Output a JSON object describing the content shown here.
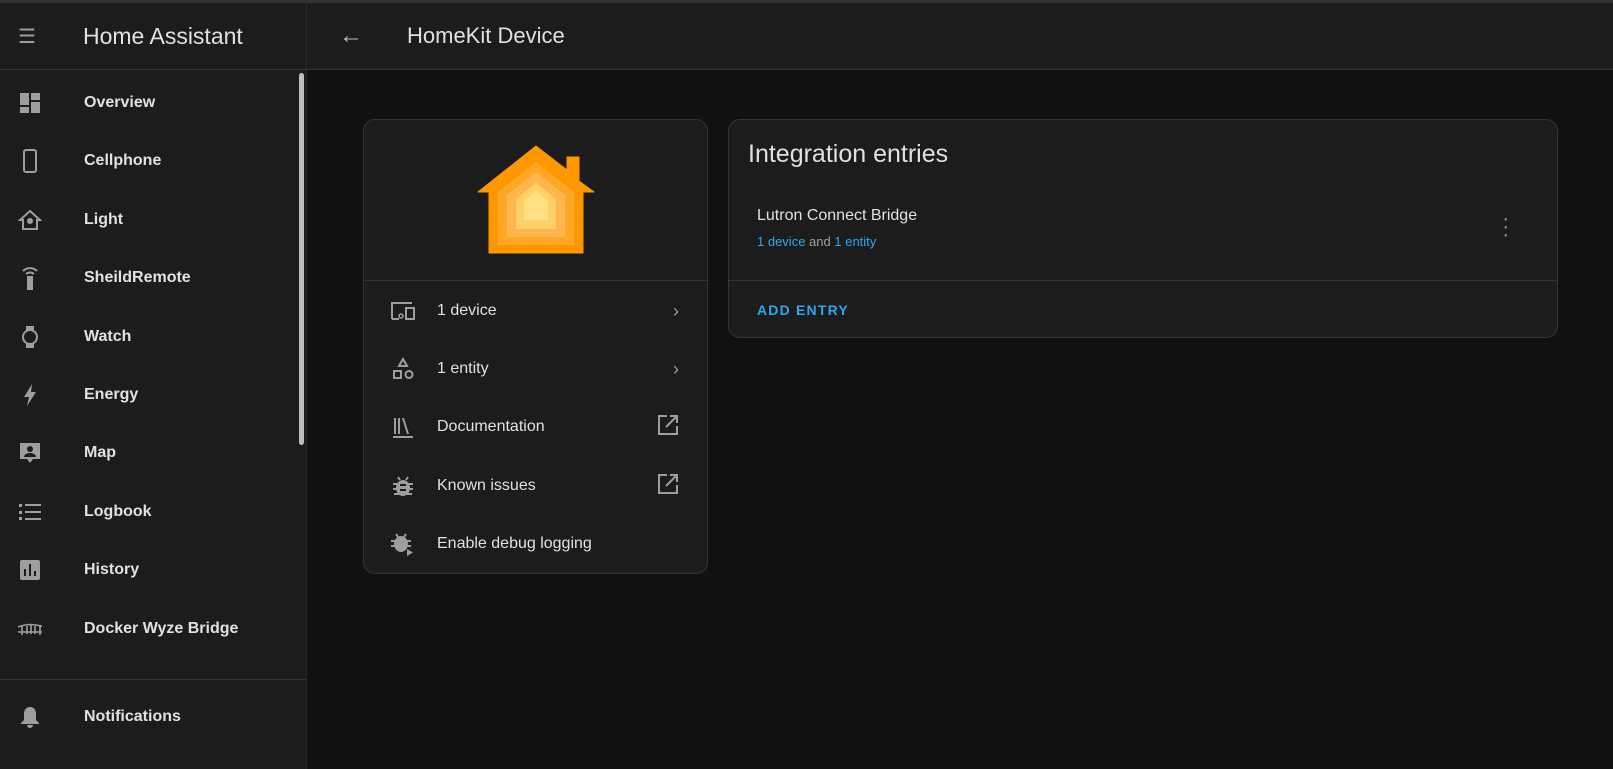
{
  "sidebar": {
    "title": "Home Assistant",
    "items": [
      {
        "label": "Overview",
        "icon": "dashboard-icon"
      },
      {
        "label": "Cellphone",
        "icon": "cellphone-icon"
      },
      {
        "label": "Light",
        "icon": "home-lightbulb-icon"
      },
      {
        "label": "SheildRemote",
        "icon": "remote-icon"
      },
      {
        "label": "Watch",
        "icon": "watch-icon"
      },
      {
        "label": "Energy",
        "icon": "lightning-bolt-icon"
      },
      {
        "label": "Map",
        "icon": "map-account-icon"
      },
      {
        "label": "Logbook",
        "icon": "format-list-icon"
      },
      {
        "label": "History",
        "icon": "chart-box-icon"
      },
      {
        "label": "Docker Wyze Bridge",
        "icon": "bridge-icon"
      }
    ],
    "notifications": "Notifications"
  },
  "header": {
    "title": "HomeKit Device"
  },
  "info_card": {
    "rows": [
      {
        "label": "1 device",
        "icon": "devices-icon",
        "end": "chevron-right-icon"
      },
      {
        "label": "1 entity",
        "icon": "shape-icon",
        "end": "chevron-right-icon"
      },
      {
        "label": "Documentation",
        "icon": "bookshelf-icon",
        "end": "open-in-new-icon"
      },
      {
        "label": "Known issues",
        "icon": "bug-icon",
        "end": "open-in-new-icon"
      },
      {
        "label": "Enable debug logging",
        "icon": "bug-play-icon",
        "end": ""
      }
    ]
  },
  "entries_card": {
    "title": "Integration entries",
    "entry": {
      "name": "Lutron Connect Bridge",
      "devices_link": "1 device",
      "and": "and",
      "entities_link": "1 entity"
    },
    "add_label": "ADD ENTRY"
  },
  "colors": {
    "accent": "#2ba7f2",
    "logo": "#ff9800"
  }
}
